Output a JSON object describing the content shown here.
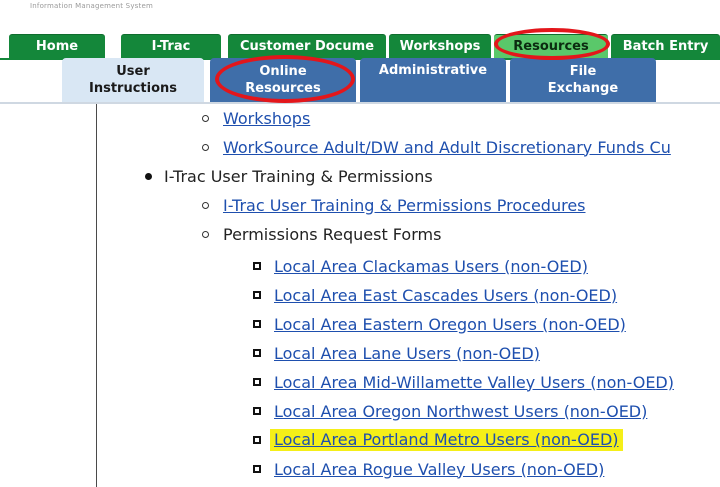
{
  "header": {
    "system_name": "Information Management System"
  },
  "nav": {
    "tabs": [
      {
        "label": "Home"
      },
      {
        "label": "I-Trac"
      },
      {
        "label": "Customer Docume"
      },
      {
        "label": "Workshops"
      },
      {
        "label": "Resources"
      },
      {
        "label": "Batch Entry"
      }
    ],
    "subtabs": [
      {
        "line1": "User",
        "line2": "Instructions"
      },
      {
        "line1": "Online",
        "line2": "Resources"
      },
      {
        "line1": "Administrative",
        "line2": ""
      },
      {
        "line1": "File",
        "line2": "Exchange"
      }
    ]
  },
  "content": {
    "links_top": [
      {
        "label": "Workshops"
      },
      {
        "label": "WorkSource Adult/DW and Adult Discretionary Funds Cu"
      }
    ],
    "section_title": "I-Trac User Training & Permissions",
    "procedures_link": "I-Trac User Training & Permissions Procedures",
    "permissions_label": "Permissions Request Forms",
    "forms": [
      {
        "label": "Local Area Clackamas Users (non-OED)"
      },
      {
        "label": "Local Area East Cascades Users (non-OED)"
      },
      {
        "label": "Local Area Eastern Oregon Users (non-OED)"
      },
      {
        "label": "Local Area Lane Users (non-OED)"
      },
      {
        "label": "Local Area Mid-Willamette Valley Users (non-OED)"
      },
      {
        "label": "Local Area Oregon Northwest Users (non-OED)"
      },
      {
        "label": "Local Area Portland Metro Users (non-OED)"
      },
      {
        "label": "Local Area Rogue Valley Users (non-OED)"
      }
    ]
  },
  "colors": {
    "tab_green": "#14873a",
    "tab_active": "#5ac86a",
    "subtab_blue": "#3f6ea9",
    "subtab_active": "#d9e7f4",
    "link": "#1e4fae",
    "highlight": "#f5ef18",
    "annotation_red": "#e3161b"
  }
}
